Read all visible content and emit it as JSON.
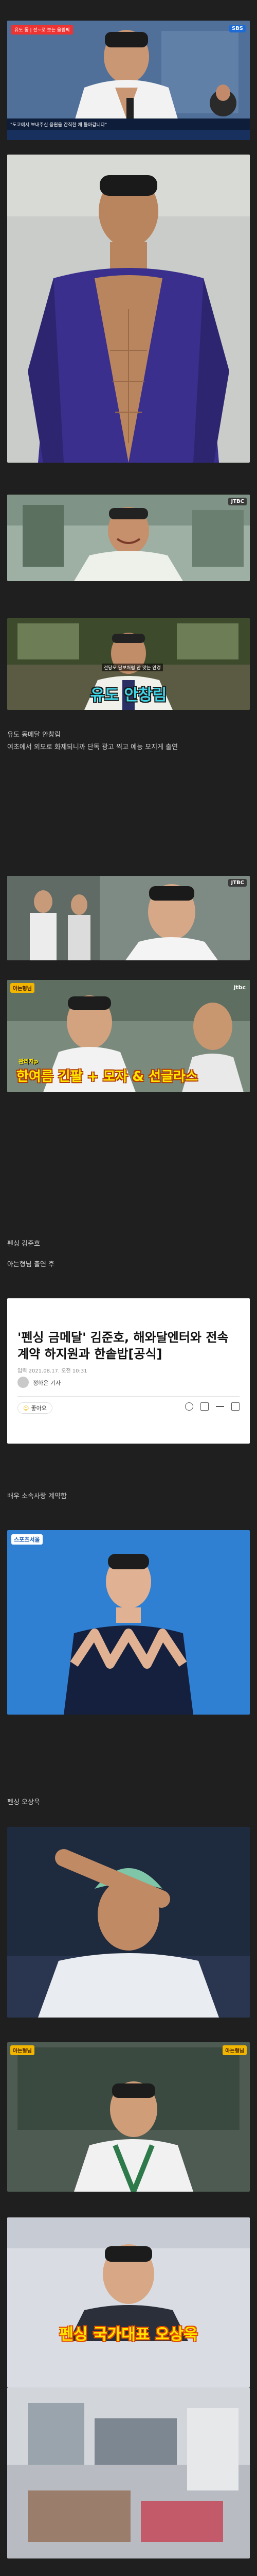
{
  "captions": {
    "c1": "유도 동메달 안창림",
    "c2": "여초에서 외모로 화제되니까 단독 광고 찍고 예능 모지게 출연",
    "c3": "펜싱 김준호",
    "c4": "아는형님 출연 후",
    "c5": "배우 소속사랑 계약함",
    "c6": "펜싱 오상욱"
  },
  "images": {
    "img1": {
      "broadcast_chip": "유도 동 | 전~로 보는 올림픽",
      "ticker": "\"도쿄에서 보내주신 응원을 간직한 채 돌아갑니다\"",
      "bug_label": "SBS"
    },
    "img3": {
      "bug_label": "JTBC"
    },
    "img4": {
      "top_label": "전당포 담보처럼 안 맞는 안경",
      "subtitle": "유도 안창림"
    },
    "img5": {
      "bug_label": "JTBC"
    },
    "img6": {
      "bug_label": "아는형님",
      "corner_label": "jtbc",
      "subtitle_small": "관리자p",
      "subtitle": "한여름 긴팔 + 모자 & 선글라스"
    },
    "img7": {
      "stamp": "스포츠서울"
    },
    "img9": {
      "bug_label": "아는형님",
      "corner_label": "아는형님"
    },
    "img10": {
      "subtitle": "펜싱 국가대표 오상욱"
    }
  },
  "news": {
    "title": "'펜싱 금메달' 김준호, 해와달엔터와 전속계약 하지원과 한솥밥[공식]",
    "meta": "입력 2021.08.17. 오전 10:31",
    "author": "정하은 기자",
    "like_label": "좋아요"
  },
  "colors": {
    "background": "#1f1f1f",
    "caption_text": "#cfcfcf",
    "subtitle_yellow": "#ffe600",
    "subtitle_orange": "#ff6a1a",
    "subtitle_cyan": "#3fd5e8",
    "judo_blue": "#3a2f8c"
  },
  "icons": [
    "like-icon",
    "share-icon",
    "font-size-icon",
    "bookmark-icon",
    "print-icon"
  ]
}
